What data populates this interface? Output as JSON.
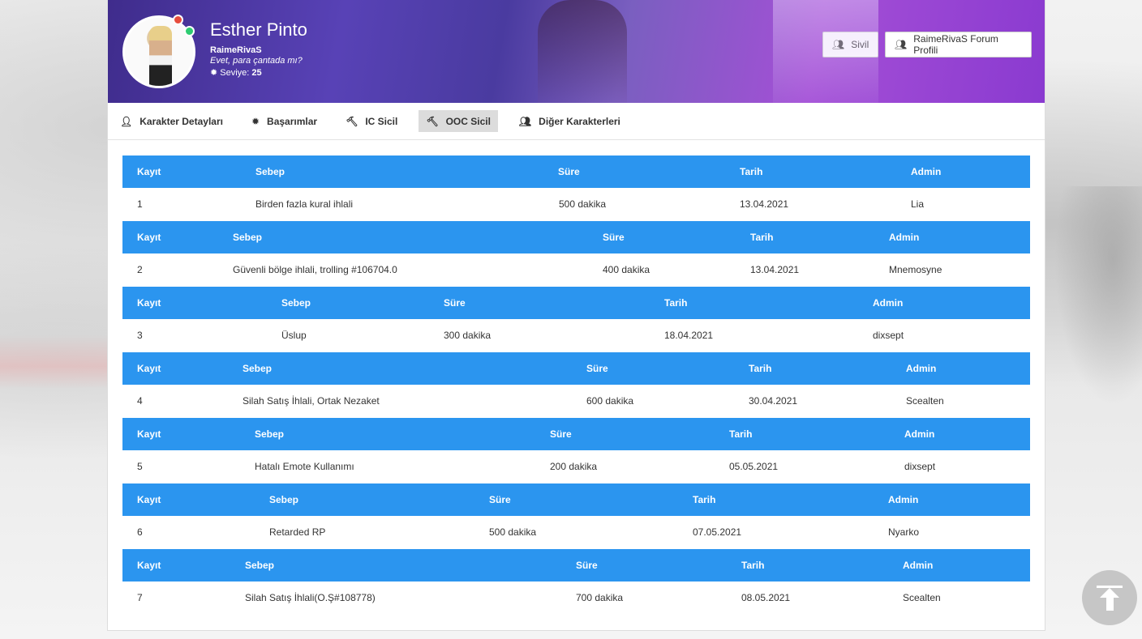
{
  "profile": {
    "name": "Esther Pinto",
    "username": "RaimeRivaS",
    "quote": "Evet, para çantada mı?",
    "level_label": "Seviye:",
    "level_value": "25"
  },
  "buttons": {
    "sivil": "Sivil",
    "forum": "RaimeRivaS Forum Profili"
  },
  "tabs": [
    {
      "label": "Karakter Detayları",
      "icon": "user-icon"
    },
    {
      "label": "Başarımlar",
      "icon": "badge-icon"
    },
    {
      "label": "IC Sicil",
      "icon": "gavel-icon"
    },
    {
      "label": "OOC Sicil",
      "icon": "gavel-icon",
      "active": true
    },
    {
      "label": "Diğer Karakterleri",
      "icon": "users-icon"
    }
  ],
  "headers": {
    "kayit": "Kayıt",
    "sebep": "Sebep",
    "sure": "Süre",
    "tarih": "Tarih",
    "admin": "Admin"
  },
  "records": [
    {
      "kayit": "1",
      "sebep": "Birden fazla kural ihlali",
      "sure": "500 dakika",
      "tarih": "13.04.2021",
      "admin": "Lia"
    },
    {
      "kayit": "2",
      "sebep": "Güvenli bölge ihlali, trolling #106704.0",
      "sure": "400 dakika",
      "tarih": "13.04.2021",
      "admin": "Mnemosyne"
    },
    {
      "kayit": "3",
      "sebep": "Üslup",
      "sure": "300 dakika",
      "tarih": "18.04.2021",
      "admin": "dixsept"
    },
    {
      "kayit": "4",
      "sebep": "Silah Satış İhlali, Ortak Nezaket",
      "sure": "600 dakika",
      "tarih": "30.04.2021",
      "admin": "Scealten"
    },
    {
      "kayit": "5",
      "sebep": "Hatalı Emote Kullanımı",
      "sure": "200 dakika",
      "tarih": "05.05.2021",
      "admin": "dixsept"
    },
    {
      "kayit": "6",
      "sebep": "Retarded RP",
      "sure": "500 dakika",
      "tarih": "07.05.2021",
      "admin": "Nyarko"
    },
    {
      "kayit": "7",
      "sebep": "Silah Satış İhlali(O.Ş#108778)",
      "sure": "700 dakika",
      "tarih": "08.05.2021",
      "admin": "Scealten"
    }
  ],
  "colors": {
    "header_blue": "#2b95ef",
    "status_online": "#2ecc71",
    "status_busy": "#e74c3c"
  }
}
